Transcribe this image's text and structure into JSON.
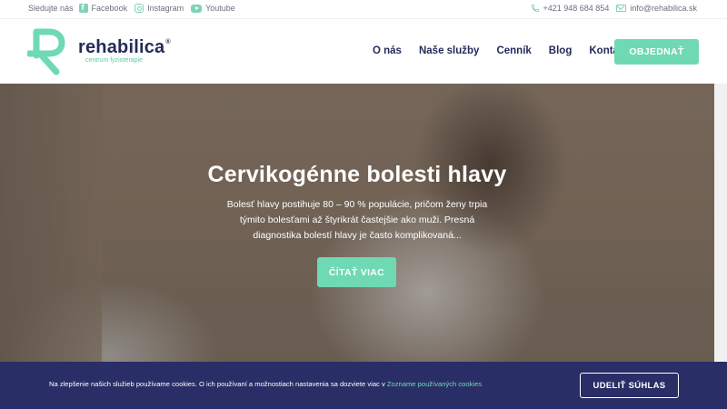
{
  "topbar": {
    "follow_label": "Sledujte nás",
    "social": [
      {
        "label": "Facebook",
        "icon": "facebook-icon"
      },
      {
        "label": "Instagram",
        "icon": "instagram-icon"
      },
      {
        "label": "Youtube",
        "icon": "youtube-icon"
      }
    ],
    "phone": "+421 948 684 854",
    "email": "info@rehabilica.sk"
  },
  "header": {
    "logo_name": "rehabilica",
    "logo_registered": "®",
    "logo_tagline": "centrum fyzioterapie",
    "nav": [
      "O nás",
      "Naše služby",
      "Cenník",
      "Blog",
      "Kontakt"
    ],
    "order_label": "OBJEDNAŤ"
  },
  "hero": {
    "title": "Cervikogénne bolesti hlavy",
    "text": "Bolesť hlavy postihuje 80 – 90 % populácie, pričom ženy trpia týmito bolesťami až štyrikrát častejšie ako muži. Presná diagnostika bolestí hlavy je často komplikovaná...",
    "button_label": "ČÍTAŤ VIAC"
  },
  "cookie": {
    "text": "Na zlepšenie našich služieb používame cookies. O ich používaní a možnostiach nastavenia sa dozviete viac v",
    "link_label": "Zozname používaných cookies",
    "accept_label": "UDELIŤ SÚHLAS"
  },
  "colors": {
    "accent": "#6fd9b3",
    "brand_dark": "#262a5a",
    "cookie_bg": "#2a2e66"
  }
}
